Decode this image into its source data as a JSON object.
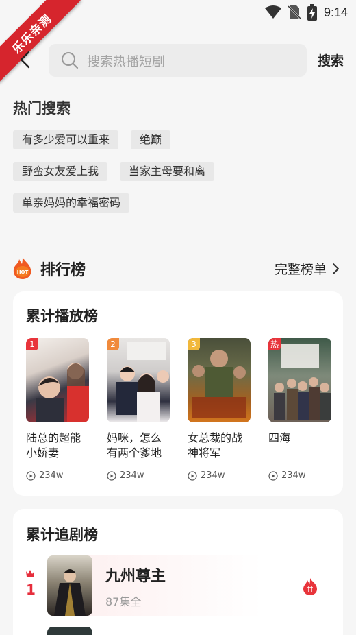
{
  "status_bar": {
    "time": "9:14"
  },
  "watermark": {
    "text": "乐乐亲测"
  },
  "search": {
    "placeholder": "搜索热播短剧",
    "button_label": "搜索"
  },
  "hot_search": {
    "title": "热门搜索",
    "rows": [
      [
        "有多少爱可以重来",
        "绝巅"
      ],
      [
        "野蛮女友爱上我",
        "当家主母要和离"
      ],
      [
        "单亲妈妈的幸福密码"
      ]
    ]
  },
  "ranking": {
    "title": "排行榜",
    "more_label": "完整榜单"
  },
  "play_chart": {
    "title": "累计播放榜",
    "items": [
      {
        "badge": "1",
        "name": "陆总的超能小娇妻",
        "plays": "234w",
        "badge_color": "#e8343b"
      },
      {
        "badge": "2",
        "name": "妈咪，怎么有两个爹地",
        "plays": "234w",
        "badge_color": "#f08a3c"
      },
      {
        "badge": "3",
        "name": "女总裁的战神将军",
        "plays": "234w",
        "badge_color": "#f1b83b"
      },
      {
        "badge": "热",
        "name": "四海",
        "plays": "234w",
        "badge_color": "#e8343b"
      }
    ]
  },
  "follow_chart": {
    "title": "累计追剧榜",
    "items": [
      {
        "rank": "1",
        "name": "九州尊主",
        "episodes": "87集全"
      }
    ]
  },
  "colors": {
    "accent_red": "#e62e3c",
    "chip_bg": "#e8e8e8",
    "page_bg": "#f6f6f6"
  }
}
